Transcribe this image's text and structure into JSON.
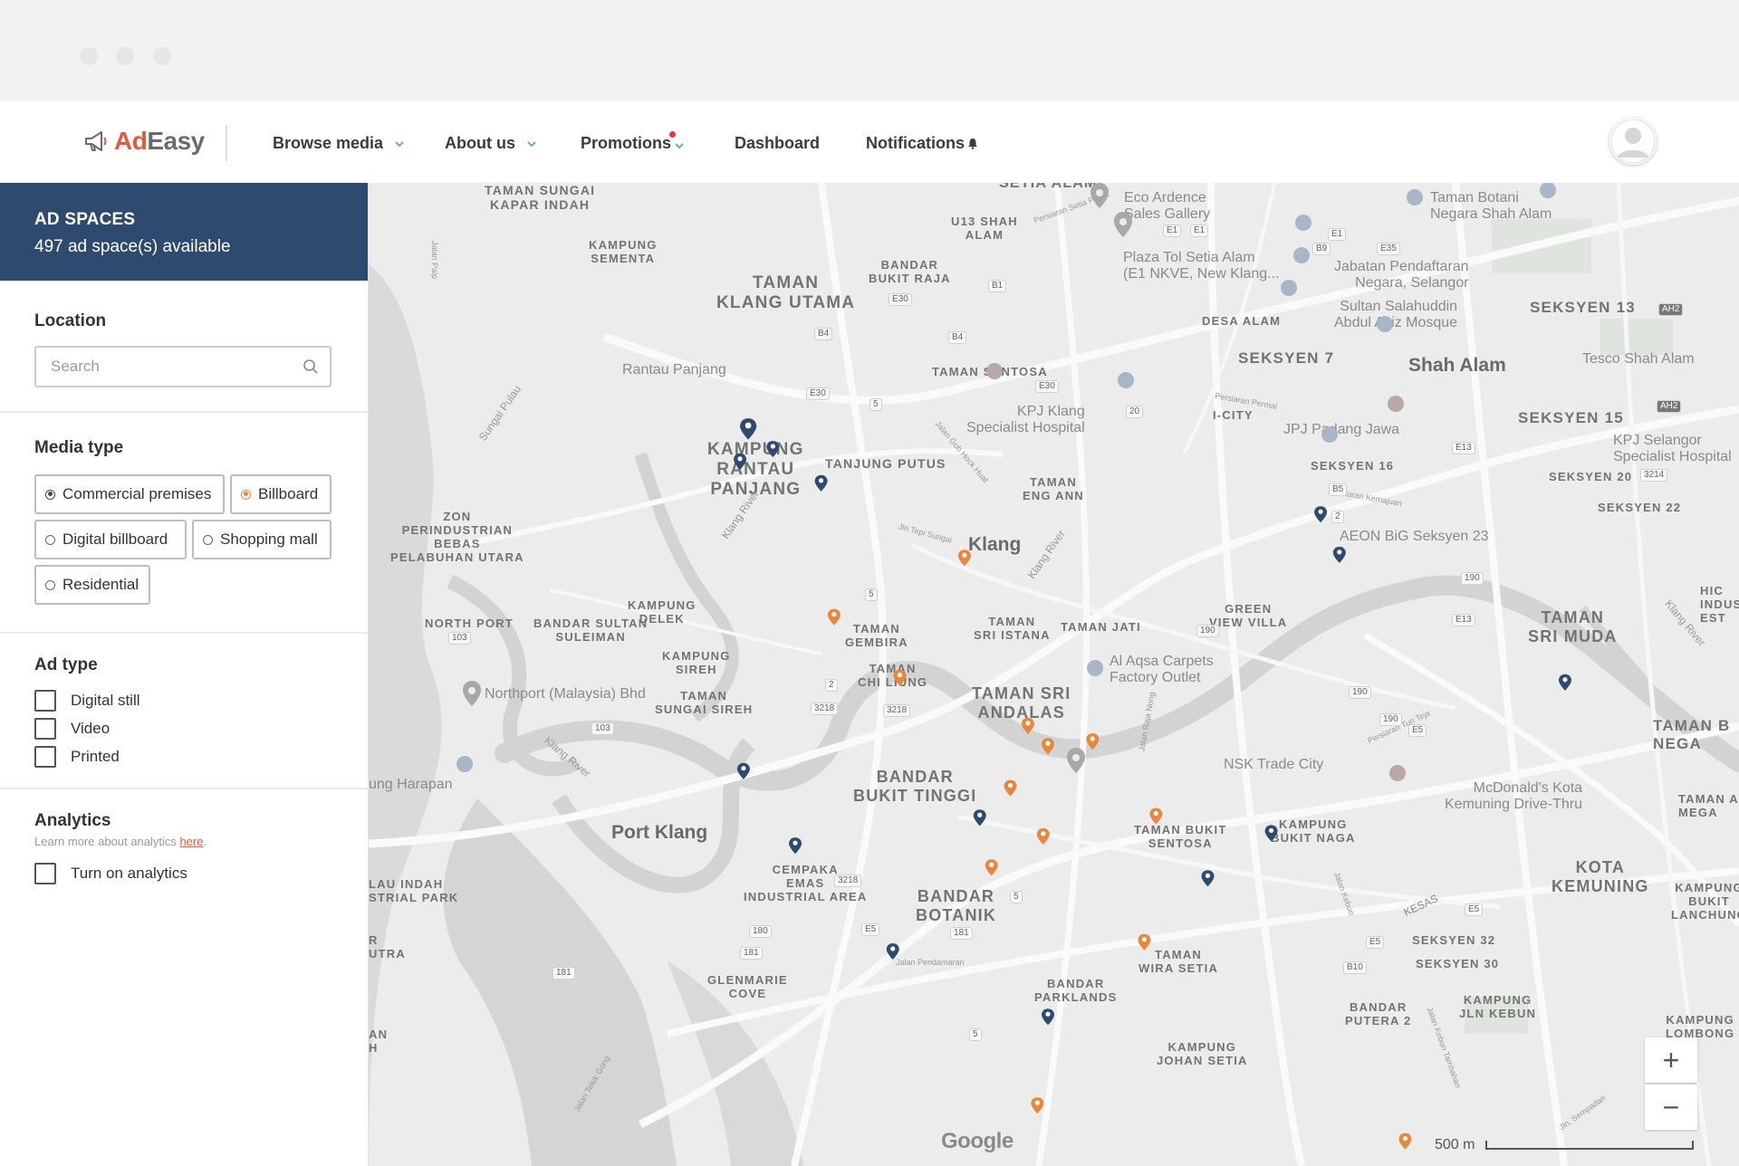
{
  "brand": {
    "logo_ad": "Ad",
    "logo_easy": "Easy",
    "accent": "#e8563c",
    "primary": "#2e4a6e",
    "secondary_accent": "#e8873c"
  },
  "nav": {
    "browse_media": "Browse media",
    "about_us": "About us",
    "promotions": "Promotions",
    "dashboard": "Dashboard",
    "notifications": "Notifications"
  },
  "sidebar": {
    "header_title": "AD SPACES",
    "header_subtitle": "497 ad space(s) available",
    "location": {
      "title": "Location",
      "placeholder": "Search"
    },
    "media_type": {
      "title": "Media type",
      "options": [
        {
          "label": "Commercial premises",
          "selected": true,
          "color": "#2e4a6e"
        },
        {
          "label": "Billboard",
          "selected": true,
          "color": "#e8873c"
        },
        {
          "label": "Digital billboard",
          "selected": false
        },
        {
          "label": "Shopping mall",
          "selected": false
        },
        {
          "label": "Residential",
          "selected": false
        }
      ]
    },
    "ad_type": {
      "title": "Ad type",
      "options": [
        {
          "label": "Digital still",
          "checked": false
        },
        {
          "label": "Video",
          "checked": false
        },
        {
          "label": "Printed",
          "checked": false
        }
      ]
    },
    "analytics": {
      "title": "Analytics",
      "note": "Learn more about analytics ",
      "link": "here",
      "after_link": ".",
      "toggle_label": "Turn on analytics"
    }
  },
  "map": {
    "areas": [
      "TAMAN SUNGAI\nKAPAR INDAH",
      "KAMPUNG\nSEMENTA",
      "TAMAN\nKLANG UTAMA",
      "BANDAR\nBUKIT RAJA",
      "U13 SHAH\nALAM",
      "SETIA ALAM",
      "DESA ALAM",
      "SEKSYEN 7",
      "SEKSYEN 13",
      "TAMAN SENTOSA",
      "KAMPUNG\nRANTAU\nPANJANG",
      "TANJUNG PUTUS",
      "TAMAN\nENG ANN",
      "I-CITY",
      "SEKSYEN 16",
      "SEKSYEN 15",
      "SEKSYEN 20",
      "SEKSYEN 22",
      "ZON\nPERINDUSTRIAN\nBEBAS\nPELABUHAN UTARA",
      "NORTH PORT",
      "BANDAR SULTAN\nSULEIMAN",
      "KAMPUNG\nDELEK",
      "TAMAN\nGEMBIRA",
      "TAMAN\nSRI ISTANA",
      "TAMAN JATI",
      "GREEN\nVIEW VILLA",
      "TAMAN\nSRI MUDA",
      "KAMPUNG\nSIREH",
      "TAMAN\nCHI LIUNG",
      "TAMAN\nSUNGAI SIREH",
      "TAMAN SRI\nANDALAS",
      "BANDAR\nBUKIT TINGGI",
      "TAMAN BUKIT\nSENTOSA",
      "KAMPUNG\nBUKIT NAGA",
      "KOTA\nKEMUNING",
      "KAMPUNG\nBUKIT\nLANCHUNG",
      "CEMPAKA\nEMAS\nINDUSTRIAL AREA",
      "BANDAR\nBOTANIK",
      "SEKSYEN 32",
      "SEKSYEN 30",
      "TAMAN\nWIRA SETIA",
      "BANDAR\nPARKLANDS",
      "BANDAR\nPUTERA 2",
      "KAMPUNG\nJLN KEBUN",
      "GLENMARIE\nCOVE",
      "KAMPUNG\nJOHAN SETIA",
      "TAMAN B\nNEGA",
      "TAMAN A\nMEGA",
      "KAMPUNG\nLOMBONG",
      "HIC\nINDUS\nEST",
      "LAU INDAH\nSTRIAL PARK",
      "R\nUTRA",
      "AN\nH"
    ],
    "cities": [
      "Shah Alam",
      "Klang",
      "Port Klang"
    ],
    "pois": [
      "Eco Ardence\nSales Gallery",
      "Taman Botani\nNegara Shah Alam",
      "Plaza Tol Setia Alam\n(E1 NKVE, New Klang...",
      "Jabatan Pendaftaran\nNegara, Selangor",
      "Sultan Salahuddin\nAbdul Aziz Mosque",
      "Tesco Shah Alam",
      "Rantau Panjang",
      "KPJ Klang\nSpecialist Hospital",
      "JPJ Padang Jawa",
      "KPJ Selangor\nSpecialist Hospital",
      "AEON BiG Seksyen 23",
      "Al Aqsa Carpets\nFactory Outlet",
      "Northport (Malaysia) Bhd",
      "NSK Trade City",
      "McDonald's Kota\nKemuning Drive-Thru",
      "ung Harapan"
    ],
    "water": [
      "Sungai Pulau",
      "Klang River",
      "Klang River",
      "Klang River",
      "Klang River"
    ],
    "streets": [
      "Persiaran Setia Prima",
      "Jalan Goh Hock Huat",
      "Jln Tepi Sungai",
      "Persiaran Permai",
      "Persiaran Kemajuan",
      "Jalan Raja Nong",
      "Persiaran Tun Teja",
      "Jalan Kebun",
      "Jalan Teluk Gong",
      "Jalan Pendamaran",
      "KESAS",
      "Jalan Kebun Tambahan",
      "Jln. Sempadan",
      "Jalan Paip"
    ],
    "road_shields": [
      "E1",
      "E1",
      "E1",
      "E35",
      "B9",
      "B1",
      "E30",
      "B4",
      "B4",
      "E30",
      "5",
      "E30",
      "20",
      "AH2",
      "AH2",
      "E13",
      "3214",
      "B5",
      "2",
      "5",
      "190",
      "E13",
      "190",
      "190",
      "103",
      "2",
      "3218",
      "3218",
      "103",
      "190",
      "E5",
      "3218",
      "5",
      "E5",
      "180",
      "181",
      "181",
      "E5",
      "B10",
      "5",
      "181",
      "E5"
    ],
    "scale_label": "500 m",
    "google_mark": "Google",
    "zoom_in": "+",
    "zoom_out": "−"
  }
}
